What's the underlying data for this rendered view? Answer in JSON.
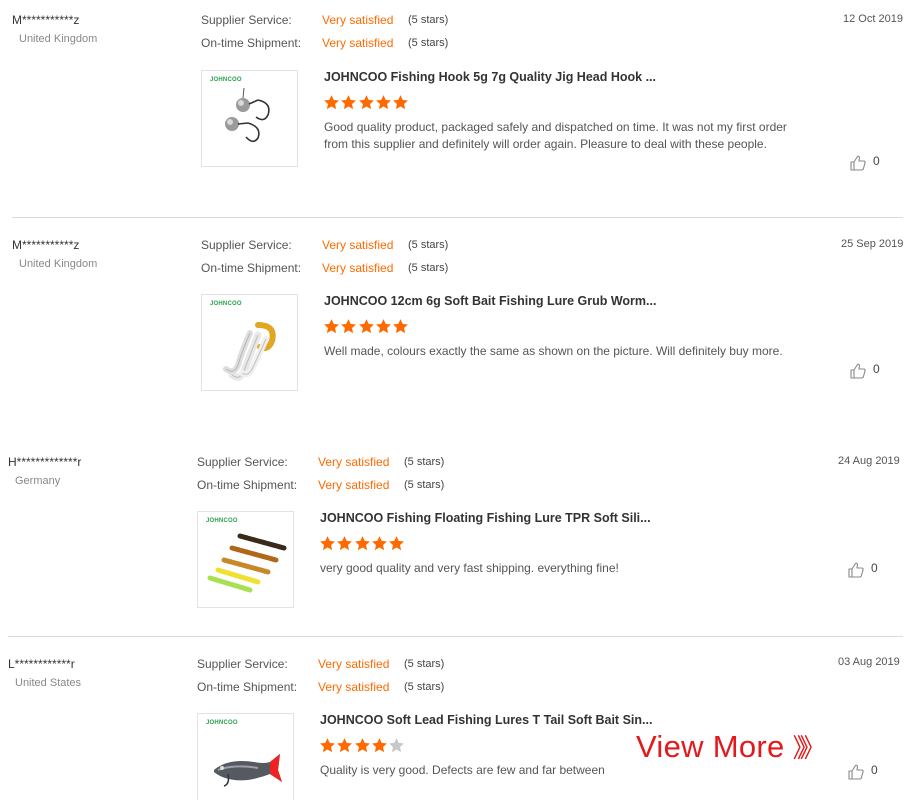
{
  "labels": {
    "supplier_service": "Supplier Service:",
    "ontime_shipment": "On-time Shipment:"
  },
  "colors": {
    "accent": "#ff6a00",
    "star_empty": "#c8c8c8",
    "view_more": "#e31a1c"
  },
  "reviews": [
    {
      "name": "M***********z",
      "country": "United Kingdom",
      "supplier_service": {
        "value": "Very satisfied",
        "stars_text": "(5 stars)"
      },
      "ontime_shipment": {
        "value": "Very satisfied",
        "stars_text": "(5 stars)"
      },
      "brand": "JOHNCOO",
      "product_title": "JOHNCOO Fishing Hook 5g 7g Quality Jig Head Hook ...",
      "rating": 5,
      "feedback": "Good quality product, packaged safely and dispatched on time. It was not my first order from this supplier and definitely will order again. Pleasure to deal with these people.",
      "date": "12 Oct 2019",
      "likes": "0",
      "product_image": "jig-head-hooks"
    },
    {
      "name": "M***********z",
      "country": "United Kingdom",
      "supplier_service": {
        "value": "Very satisfied",
        "stars_text": "(5 stars)"
      },
      "ontime_shipment": {
        "value": "Very satisfied",
        "stars_text": "(5 stars)"
      },
      "brand": "JOHNCOO",
      "product_title": "JOHNCOO 12cm 6g Soft Bait Fishing Lure Grub Worm...",
      "rating": 5,
      "feedback": "Well made, colours exactly the same as shown on the picture. Will definitely buy more.",
      "date": "25 Sep 2019",
      "likes": "0",
      "product_image": "grub-worms"
    },
    {
      "name": "H*************r",
      "country": "Germany",
      "supplier_service": {
        "value": "Very satisfied",
        "stars_text": "(5 stars)"
      },
      "ontime_shipment": {
        "value": "Very satisfied",
        "stars_text": "(5 stars)"
      },
      "brand": "JOHNCOO",
      "product_title": "JOHNCOO Fishing Floating Fishing Lure TPR Soft Sili...",
      "rating": 5,
      "feedback": "very good quality and very fast shipping. everything fine!",
      "date": "24 Aug 2019",
      "likes": "0",
      "product_image": "floating-soft-lures"
    },
    {
      "name": "L************r",
      "country": "United States",
      "supplier_service": {
        "value": "Very satisfied",
        "stars_text": "(5 stars)"
      },
      "ontime_shipment": {
        "value": "Very satisfied",
        "stars_text": "(5 stars)"
      },
      "brand": "JOHNCOO",
      "product_title": "JOHNCOO Soft Lead Fishing Lures T Tail Soft Bait Sin...",
      "rating": 4,
      "feedback": "Quality is very good. Defects are few and far between",
      "date": "03 Aug 2019",
      "likes": "0",
      "product_image": "t-tail-soft-bait"
    }
  ],
  "view_more": {
    "label": "View More",
    "arrows": "》》"
  }
}
